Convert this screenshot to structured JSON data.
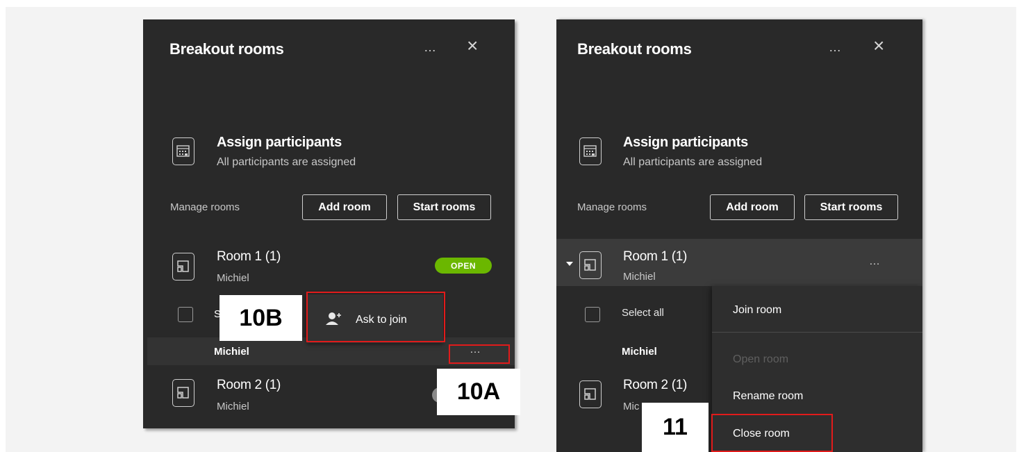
{
  "left_panel": {
    "title": "Breakout rooms",
    "more": "…",
    "close": "×",
    "assign": {
      "title": "Assign participants",
      "subtitle": "All participants are assigned"
    },
    "manage_label": "Manage rooms",
    "add_room": "Add room",
    "start_rooms": "Start rooms",
    "room1": {
      "name": "Room 1 (1)",
      "member": "Michiel",
      "status": "OPEN"
    },
    "select_all_partial": "S",
    "ask_to_join": "Ask to join",
    "participant": "Michiel",
    "participant_more": "…",
    "room2": {
      "name": "Room 2 (1)",
      "member": "Michiel"
    }
  },
  "right_panel": {
    "title": "Breakout rooms",
    "more": "…",
    "close": "×",
    "assign": {
      "title": "Assign participants",
      "subtitle": "All participants are assigned"
    },
    "manage_label": "Manage rooms",
    "add_room": "Add room",
    "start_rooms": "Start rooms",
    "room1": {
      "name": "Room 1 (1)",
      "member": "Michiel",
      "more": "…"
    },
    "select_all": "Select all",
    "participant": "Michiel",
    "room2": {
      "name": "Room 2 (1)",
      "member_partial": "Mic"
    },
    "menu": {
      "join_room": "Join room",
      "open_room": "Open room",
      "rename_room": "Rename room",
      "close_room": "Close room"
    }
  },
  "callouts": {
    "a": "10A",
    "b": "10B",
    "c": "11"
  },
  "colors": {
    "panel": "#292929",
    "open_badge": "#6bb700",
    "highlight": "#e11b1b"
  },
  "icons": [
    "calendar-grid-icon",
    "room-icon",
    "person-add-icon",
    "chevron-down-icon",
    "more-icon",
    "close-icon"
  ]
}
